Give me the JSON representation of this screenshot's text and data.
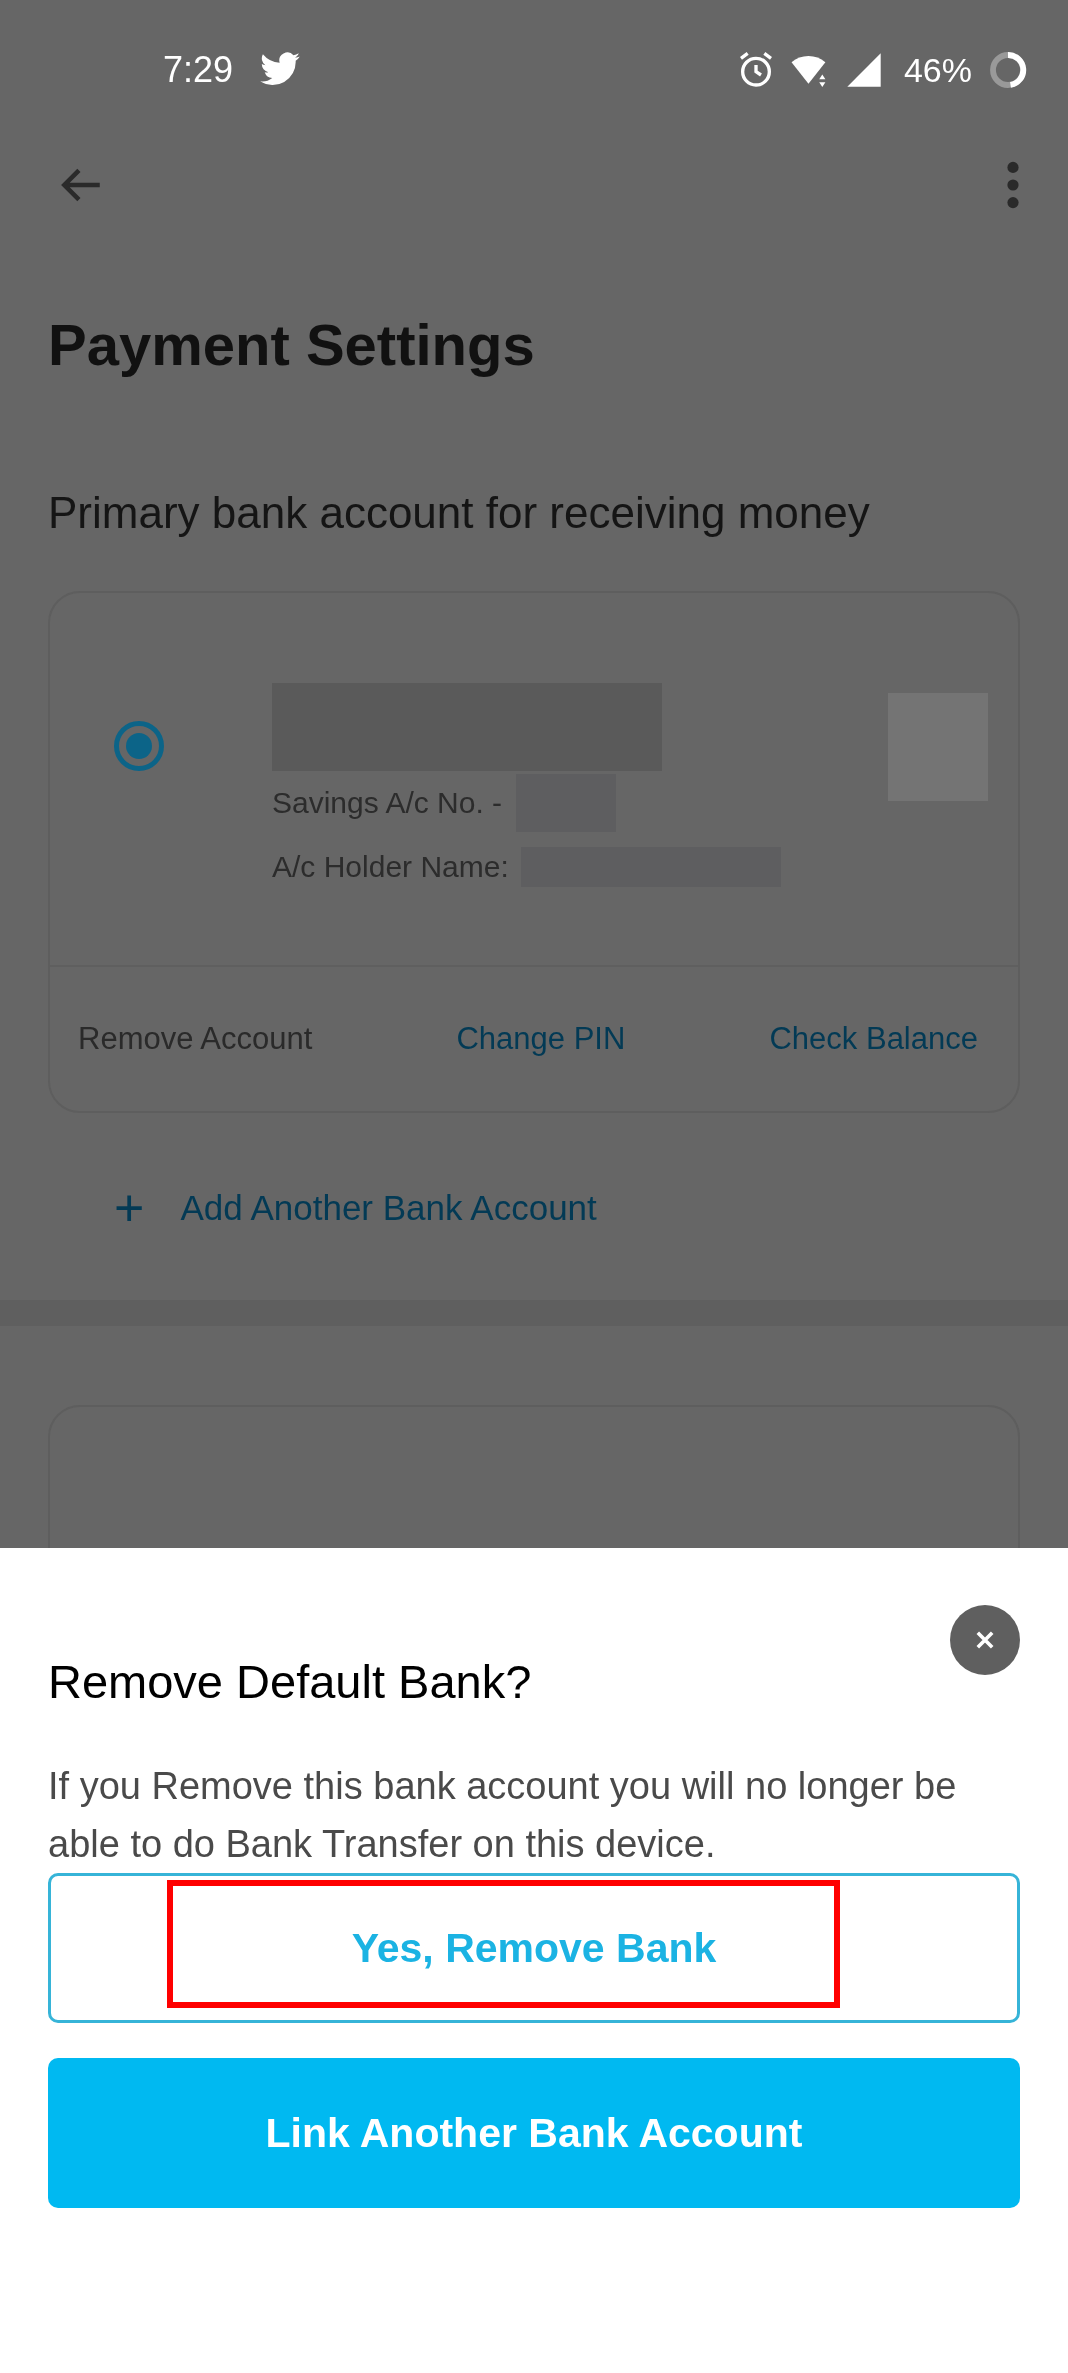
{
  "status_bar": {
    "time": "7:29",
    "battery": "46%"
  },
  "page": {
    "title": "Payment Settings",
    "section_title": "Primary bank account for receiving money"
  },
  "bank_card": {
    "selected": true,
    "account_label": "Savings A/c No. -",
    "holder_label": "A/c Holder Name:",
    "actions": [
      {
        "label": "Remove Account",
        "kind": "plain"
      },
      {
        "label": "Change PIN",
        "kind": "link"
      },
      {
        "label": "Check Balance",
        "kind": "link"
      }
    ]
  },
  "add_account": {
    "icon": "+",
    "label": "Add Another Bank Account"
  },
  "dialog": {
    "title": "Remove Default Bank?",
    "message": "If you Remove this bank account you will no longer be able to do Bank Transfer on this device.",
    "buttons": [
      {
        "label": "Yes, Remove Bank",
        "kind": "outline",
        "highlighted": true
      },
      {
        "label": "Link Another Bank Account",
        "kind": "filled",
        "highlighted": false
      }
    ]
  }
}
